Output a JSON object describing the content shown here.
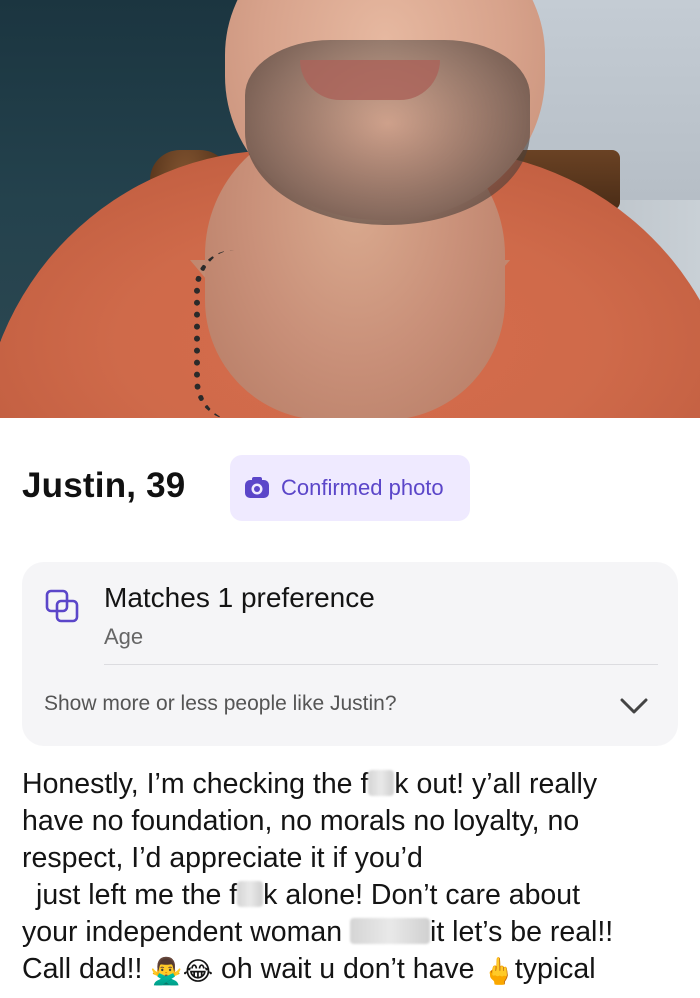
{
  "profile": {
    "name_age": "Justin, 39",
    "badge_label": "Confirmed photo"
  },
  "preference_card": {
    "title": "Matches 1 preference",
    "subtitle": "Age",
    "question": "Show more or less people like Justin?"
  },
  "bio": {
    "line1_a": "Honestly, I’m checking the f",
    "line1_b": "k out! y’all really",
    "line2": "have no foundation, no morals no loyalty, no",
    "line3": "respect, I’d appreciate it if you’d",
    "line4_a": "just left me the f",
    "line4_b": "k alone! Don’t care about",
    "line5_a": "your independent woman",
    "line5_b": "it let’s be real!!",
    "line6_a": "Call dad!!",
    "line6_b": "oh wait u  don’t have",
    "line6_c": "typical",
    "emoji_1": "🙅‍♂️",
    "emoji_2": "😂",
    "emoji_3": "🖕"
  },
  "colors": {
    "badge_bg": "#efeaff",
    "badge_accent": "#5b46c9",
    "card_bg": "#f5f5f7"
  },
  "icons": {
    "badge": "camera-icon",
    "card": "overlapping-squares-icon",
    "expand": "chevron-down-icon"
  }
}
